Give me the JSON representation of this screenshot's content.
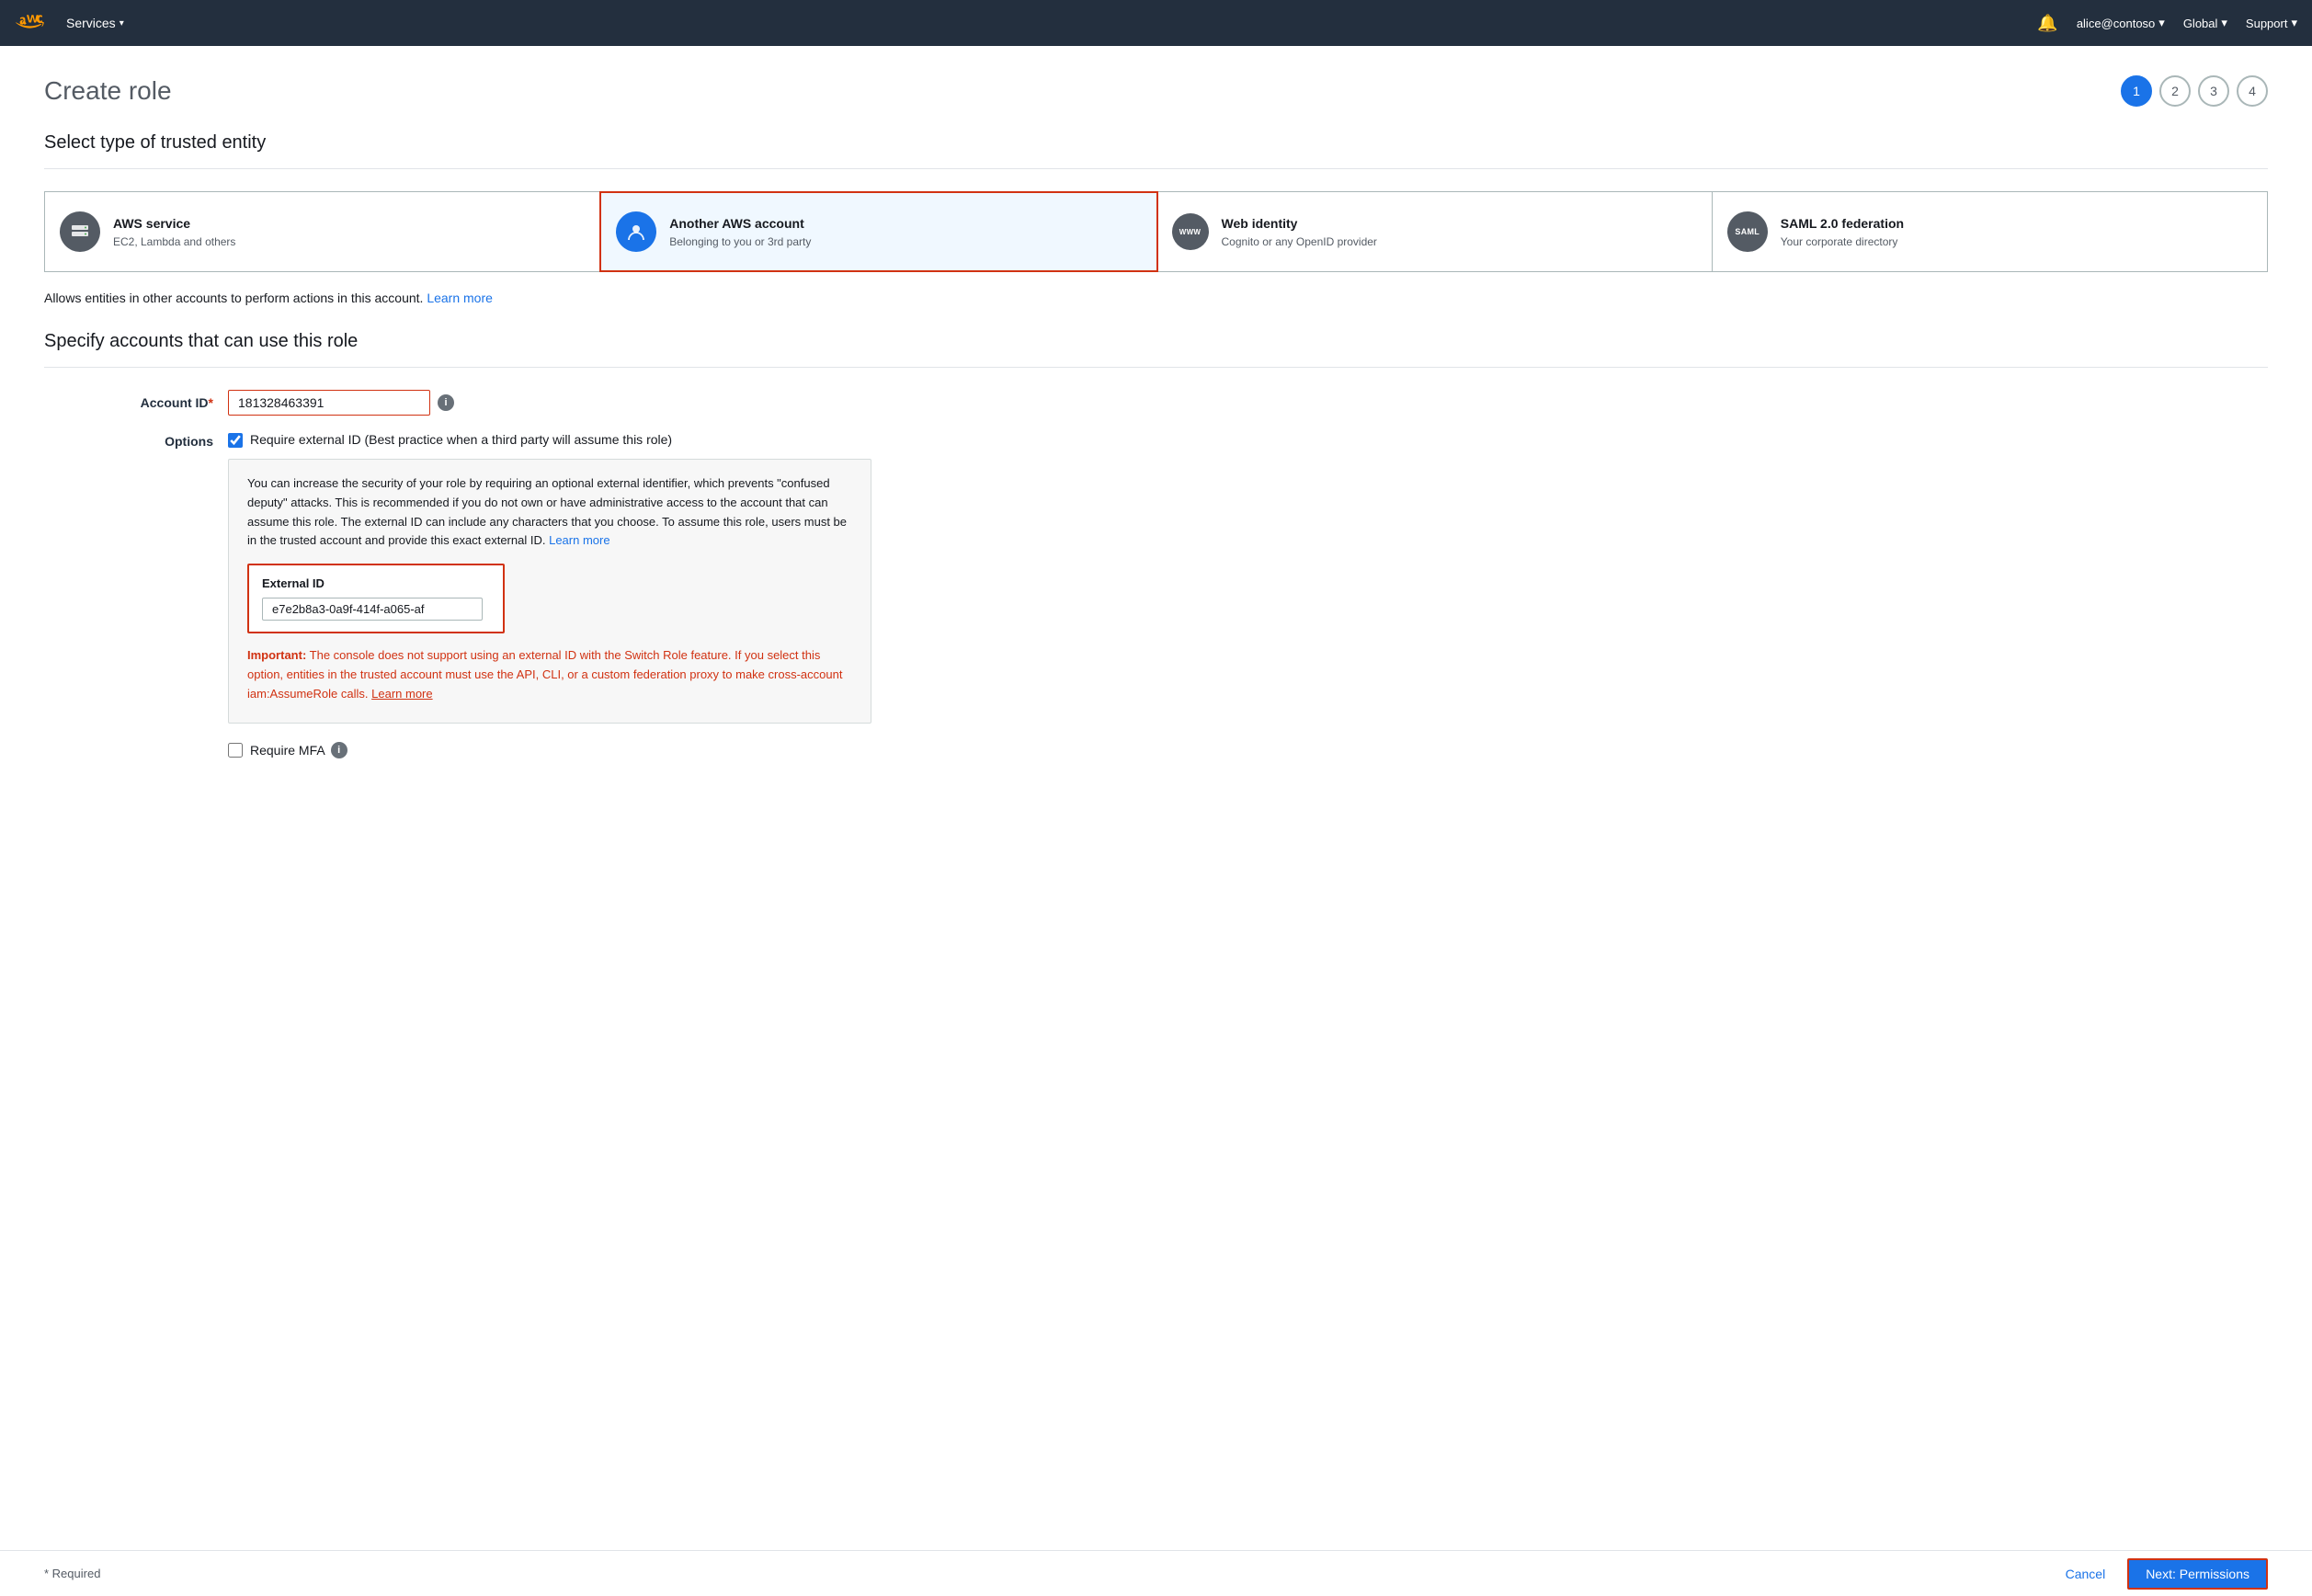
{
  "nav": {
    "services_label": "Services",
    "bell_label": "Notifications",
    "user_label": "alice@contoso",
    "region_label": "Global",
    "support_label": "Support"
  },
  "page": {
    "title": "Create role",
    "steps": [
      1,
      2,
      3,
      4
    ],
    "active_step": 1
  },
  "select_entity": {
    "heading": "Select type of trusted entity",
    "cards": [
      {
        "id": "aws-service",
        "icon": "server-icon",
        "title": "AWS service",
        "subtitle": "EC2, Lambda and others",
        "selected": false
      },
      {
        "id": "another-aws-account",
        "icon": "person-icon",
        "title": "Another AWS account",
        "subtitle": "Belonging to you or 3rd party",
        "selected": true
      },
      {
        "id": "web-identity",
        "icon": "web-icon",
        "title": "Web identity",
        "subtitle": "Cognito or any OpenID provider",
        "selected": false
      },
      {
        "id": "saml-federation",
        "icon": "saml-icon",
        "title": "SAML 2.0 federation",
        "subtitle": "Your corporate directory",
        "selected": false
      }
    ]
  },
  "description": {
    "text": "Allows entities in other accounts to perform actions in this account.",
    "link_text": "Learn more"
  },
  "specify_accounts": {
    "heading": "Specify accounts that can use this role",
    "account_id_label": "Account ID",
    "account_id_required": "*",
    "account_id_value": "181328463391",
    "options_label": "Options",
    "checkbox_label": "Require external ID (Best practice when a third party will assume this role)",
    "checkbox_checked": true,
    "external_id_box": {
      "description": "You can increase the security of your role by requiring an optional external identifier, which prevents \"confused deputy\" attacks. This is recommended if you do not own or have administrative access to the account that can assume this role. The external ID can include any characters that you choose. To assume this role, users must be in the trusted account and provide this exact external ID.",
      "learn_more_link": "Learn more",
      "external_id_label": "External ID",
      "external_id_value": "e7e2b8a3-0a9f-414f-a065-af"
    },
    "important_prefix": "Important:",
    "important_text": "The console does not support using an external ID with the Switch Role feature. If you select this option, entities in the trusted account must use the API, CLI, or a custom federation proxy to make cross-account iam:AssumeRole calls.",
    "important_link": "Learn more",
    "require_mfa_label": "Require MFA"
  },
  "footer": {
    "required_note": "* Required",
    "cancel_label": "Cancel",
    "next_label": "Next: Permissions"
  }
}
